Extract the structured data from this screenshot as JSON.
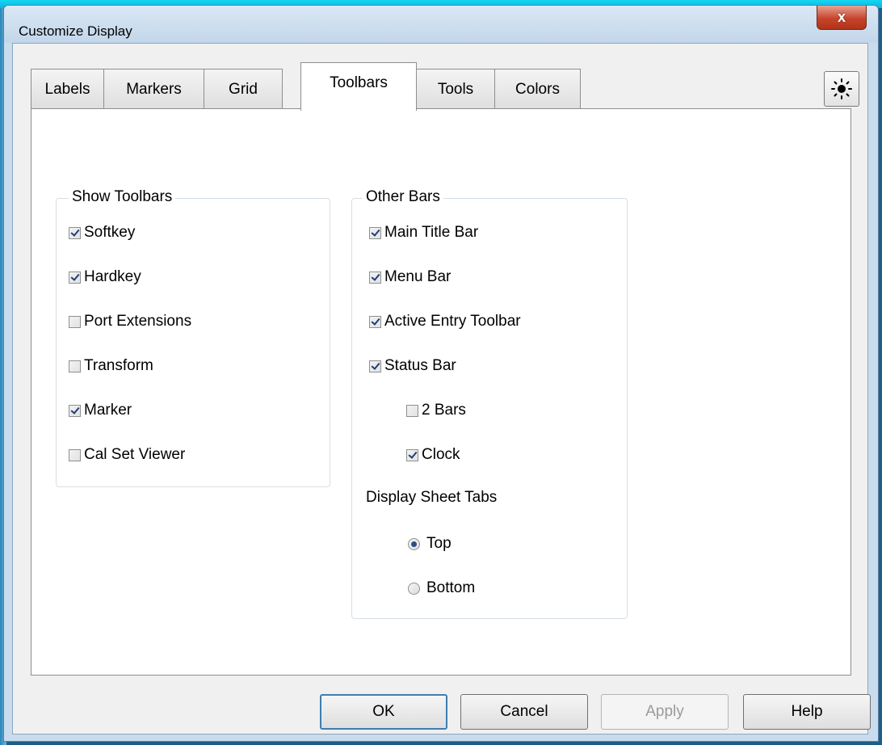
{
  "window": {
    "title": "Customize Display",
    "close_glyph": "x"
  },
  "tabs": [
    {
      "label": "Labels"
    },
    {
      "label": "Markers"
    },
    {
      "label": "Grid"
    },
    {
      "label": "Toolbars",
      "active": true
    },
    {
      "label": "Tools"
    },
    {
      "label": "Colors"
    }
  ],
  "sun_button_icon": "sun-icon",
  "show_toolbars": {
    "title": "Show Toolbars",
    "items": [
      {
        "label": "Softkey",
        "checked": true
      },
      {
        "label": "Hardkey",
        "checked": true
      },
      {
        "label": "Port Extensions",
        "checked": false
      },
      {
        "label": "Transform",
        "checked": false
      },
      {
        "label": "Marker",
        "checked": true
      },
      {
        "label": "Cal Set Viewer",
        "checked": false
      }
    ]
  },
  "other_bars": {
    "title": "Other Bars",
    "items": [
      {
        "label": "Main Title Bar",
        "checked": true
      },
      {
        "label": "Menu Bar",
        "checked": true
      },
      {
        "label": "Active Entry Toolbar",
        "checked": true
      },
      {
        "label": "Status Bar",
        "checked": true
      }
    ],
    "status_sub": [
      {
        "label": "2 Bars",
        "checked": false
      },
      {
        "label": "Clock",
        "checked": true
      }
    ],
    "sheet_tabs_label": "Display Sheet Tabs",
    "sheet_tabs": [
      {
        "label": "Top",
        "selected": true
      },
      {
        "label": "Bottom",
        "selected": false
      }
    ]
  },
  "buttons": {
    "ok": "OK",
    "cancel": "Cancel",
    "apply": "Apply",
    "help": "Help"
  }
}
